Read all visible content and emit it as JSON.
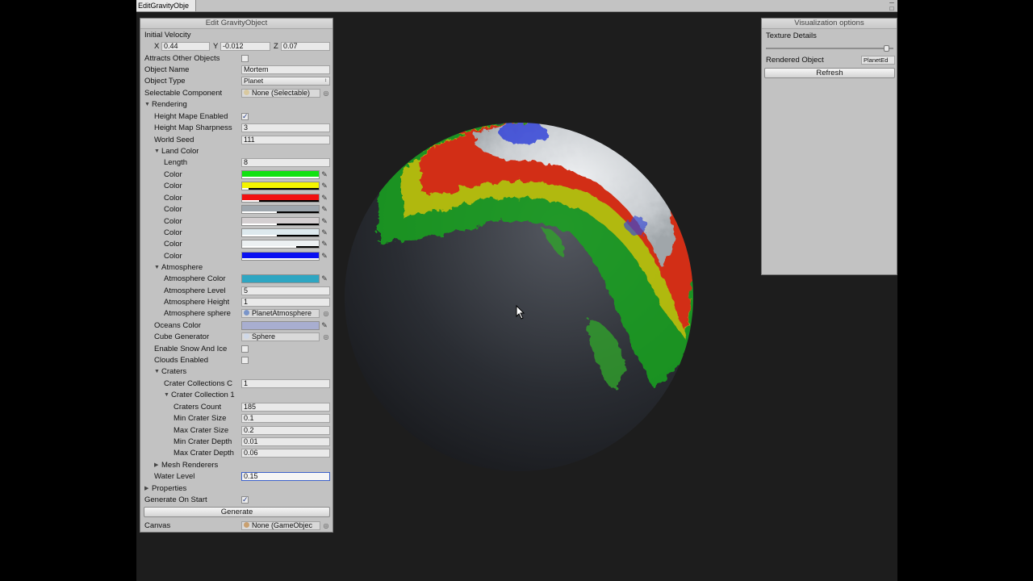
{
  "window": {
    "tab_label": "EditGravityObje",
    "controls": "─ □"
  },
  "left_panel": {
    "title": "Edit GravityObject",
    "initial_velocity": {
      "label": "Initial Velocity",
      "x_label": "X",
      "x": "0.44",
      "y_label": "Y",
      "y": "-0.012",
      "z_label": "Z",
      "z": "0.07"
    },
    "attracts_label": "Attracts Other Objects",
    "object_name": {
      "label": "Object Name",
      "value": "Mortem"
    },
    "object_type": {
      "label": "Object Type",
      "value": "Planet"
    },
    "selectable": {
      "label": "Selectable Component",
      "value": "None (Selectable)"
    },
    "rendering": {
      "label": "Rendering",
      "height_map_enabled": "Height Mape Enabled",
      "height_map_sharpness": {
        "label": "Height Map Sharpness",
        "value": "3"
      },
      "world_seed": {
        "label": "World Seed",
        "value": "111"
      },
      "land_color": {
        "label": "Land Color",
        "length_label": "Length",
        "length": "8",
        "color_label": "Color",
        "colors": [
          {
            "hex": "#12e212",
            "alpha": 1.0
          },
          {
            "hex": "#f4f400",
            "alpha": 0.08
          },
          {
            "hex": "#f21010",
            "alpha": 0.22
          },
          {
            "hex": "#9ea6ad",
            "alpha": 0.45
          },
          {
            "hex": "#d4cfd1",
            "alpha": 0.45
          },
          {
            "hex": "#dde9ee",
            "alpha": 0.45
          },
          {
            "hex": "#ecf0f2",
            "alpha": 0.7
          },
          {
            "hex": "#0a10f2",
            "alpha": 1.0
          }
        ]
      },
      "atmosphere": {
        "label": "Atmosphere",
        "color_label": "Atmosphere Color",
        "color": "#2ea6c2",
        "level": {
          "label": "Atmosphere Level",
          "value": "5"
        },
        "height": {
          "label": "Atmosphere Height",
          "value": "1"
        },
        "sphere": {
          "label": "Atmosphere sphere",
          "value": "PlanetAtmosphere"
        }
      },
      "oceans_color": {
        "label": "Oceans Color",
        "color": "#a8aed0"
      },
      "cube_generator": {
        "label": "Cube Generator",
        "value": "Sphere"
      },
      "snow_ice_label": "Enable Snow And Ice",
      "clouds_label": "Clouds Enabled",
      "craters": {
        "label": "Craters",
        "collections": {
          "label": "Crater Collections C",
          "value": "1"
        },
        "collection_1": {
          "label": "Crater Collection 1",
          "count": {
            "label": "Craters Count",
            "value": "185"
          },
          "min_size": {
            "label": "Min Crater Size",
            "value": "0.1"
          },
          "max_size": {
            "label": "Max Crater Size",
            "value": "0.2"
          },
          "min_depth": {
            "label": "Min Crater Depth",
            "value": "0.01"
          },
          "max_depth": {
            "label": "Max Crater Depth",
            "value": "0.06"
          }
        }
      },
      "mesh_renderers": "Mesh Renderers",
      "water_level": {
        "label": "Water Level",
        "value": "0.15"
      }
    },
    "properties": "Properties",
    "generate_on_start": "Generate On Start",
    "generate_button": "Generate",
    "canvas": {
      "label": "Canvas",
      "value": "None (GameObjec"
    },
    "checkboxes": {
      "attracts": false,
      "height_map": true,
      "snow_ice": false,
      "clouds": false,
      "generate_on_start": true
    },
    "check_glyph": "✓",
    "expanded_glyph": "▼",
    "collapsed_glyph": "▶",
    "picker_glyph": "✎",
    "target_glyph": "◎",
    "select_arrow": "↕"
  },
  "right_panel": {
    "title": "Visualization options",
    "texture_details": "Texture Details",
    "texture_slider_value": 0.95,
    "rendered_object_label": "Rendered Object",
    "rendered_object_value": "PlanetEd",
    "refresh_button": "Refresh"
  },
  "colors": {
    "accent_focus": "#3d62c9",
    "panel_bg": "#c2c2c2",
    "viewport_bg": "#1d1d1d"
  }
}
